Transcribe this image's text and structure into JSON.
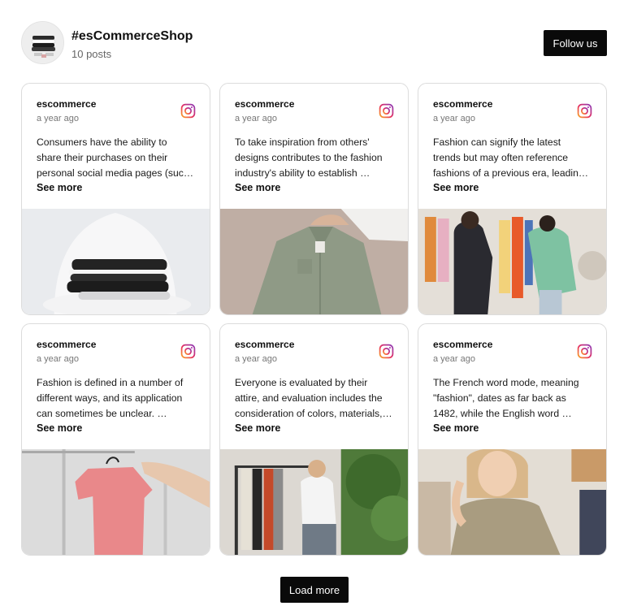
{
  "header": {
    "shop_name": "#esCommerceShop",
    "post_count": "10 posts",
    "follow_label": "Follow us"
  },
  "posts": [
    {
      "username": "escommerce",
      "time": "a year ago",
      "lines": [
        "Consumers have the ability to",
        "share their purchases on their",
        "personal social media pages (suc…"
      ],
      "see_more": "See more",
      "icon": "instagram-icon"
    },
    {
      "username": "escommerce",
      "time": "a year ago",
      "lines": [
        "To take inspiration from others'",
        "designs contributes to the fashion",
        "industry's ability to establish …"
      ],
      "see_more": "See more",
      "icon": "instagram-icon"
    },
    {
      "username": "escommerce",
      "time": "a year ago",
      "lines": [
        "Fashion can signify the latest",
        "trends but may often reference",
        "fashions of a previous era, leadin…"
      ],
      "see_more": "See more",
      "icon": "instagram-icon"
    },
    {
      "username": "escommerce",
      "time": "a year ago",
      "lines": [
        "Fashion is defined in a number of",
        "different ways, and its application",
        "can sometimes be unclear. …"
      ],
      "see_more": "See more",
      "icon": "instagram-icon"
    },
    {
      "username": "escommerce",
      "time": "a year ago",
      "lines": [
        "Everyone is evaluated by their",
        "attire, and evaluation includes the",
        "consideration of colors, materials,…"
      ],
      "see_more": "See more",
      "icon": "instagram-icon"
    },
    {
      "username": "escommerce",
      "time": "a year ago",
      "lines": [
        "The French word mode, meaning",
        "\"fashion\", dates as far back as",
        "1482, while the English word …"
      ],
      "see_more": "See more",
      "icon": "instagram-icon"
    }
  ],
  "load_more_label": "Load more",
  "colors": {
    "button_bg": "#0a0a0a",
    "button_text": "#ffffff",
    "card_border": "#dcdcdc",
    "muted_text": "#777777"
  }
}
